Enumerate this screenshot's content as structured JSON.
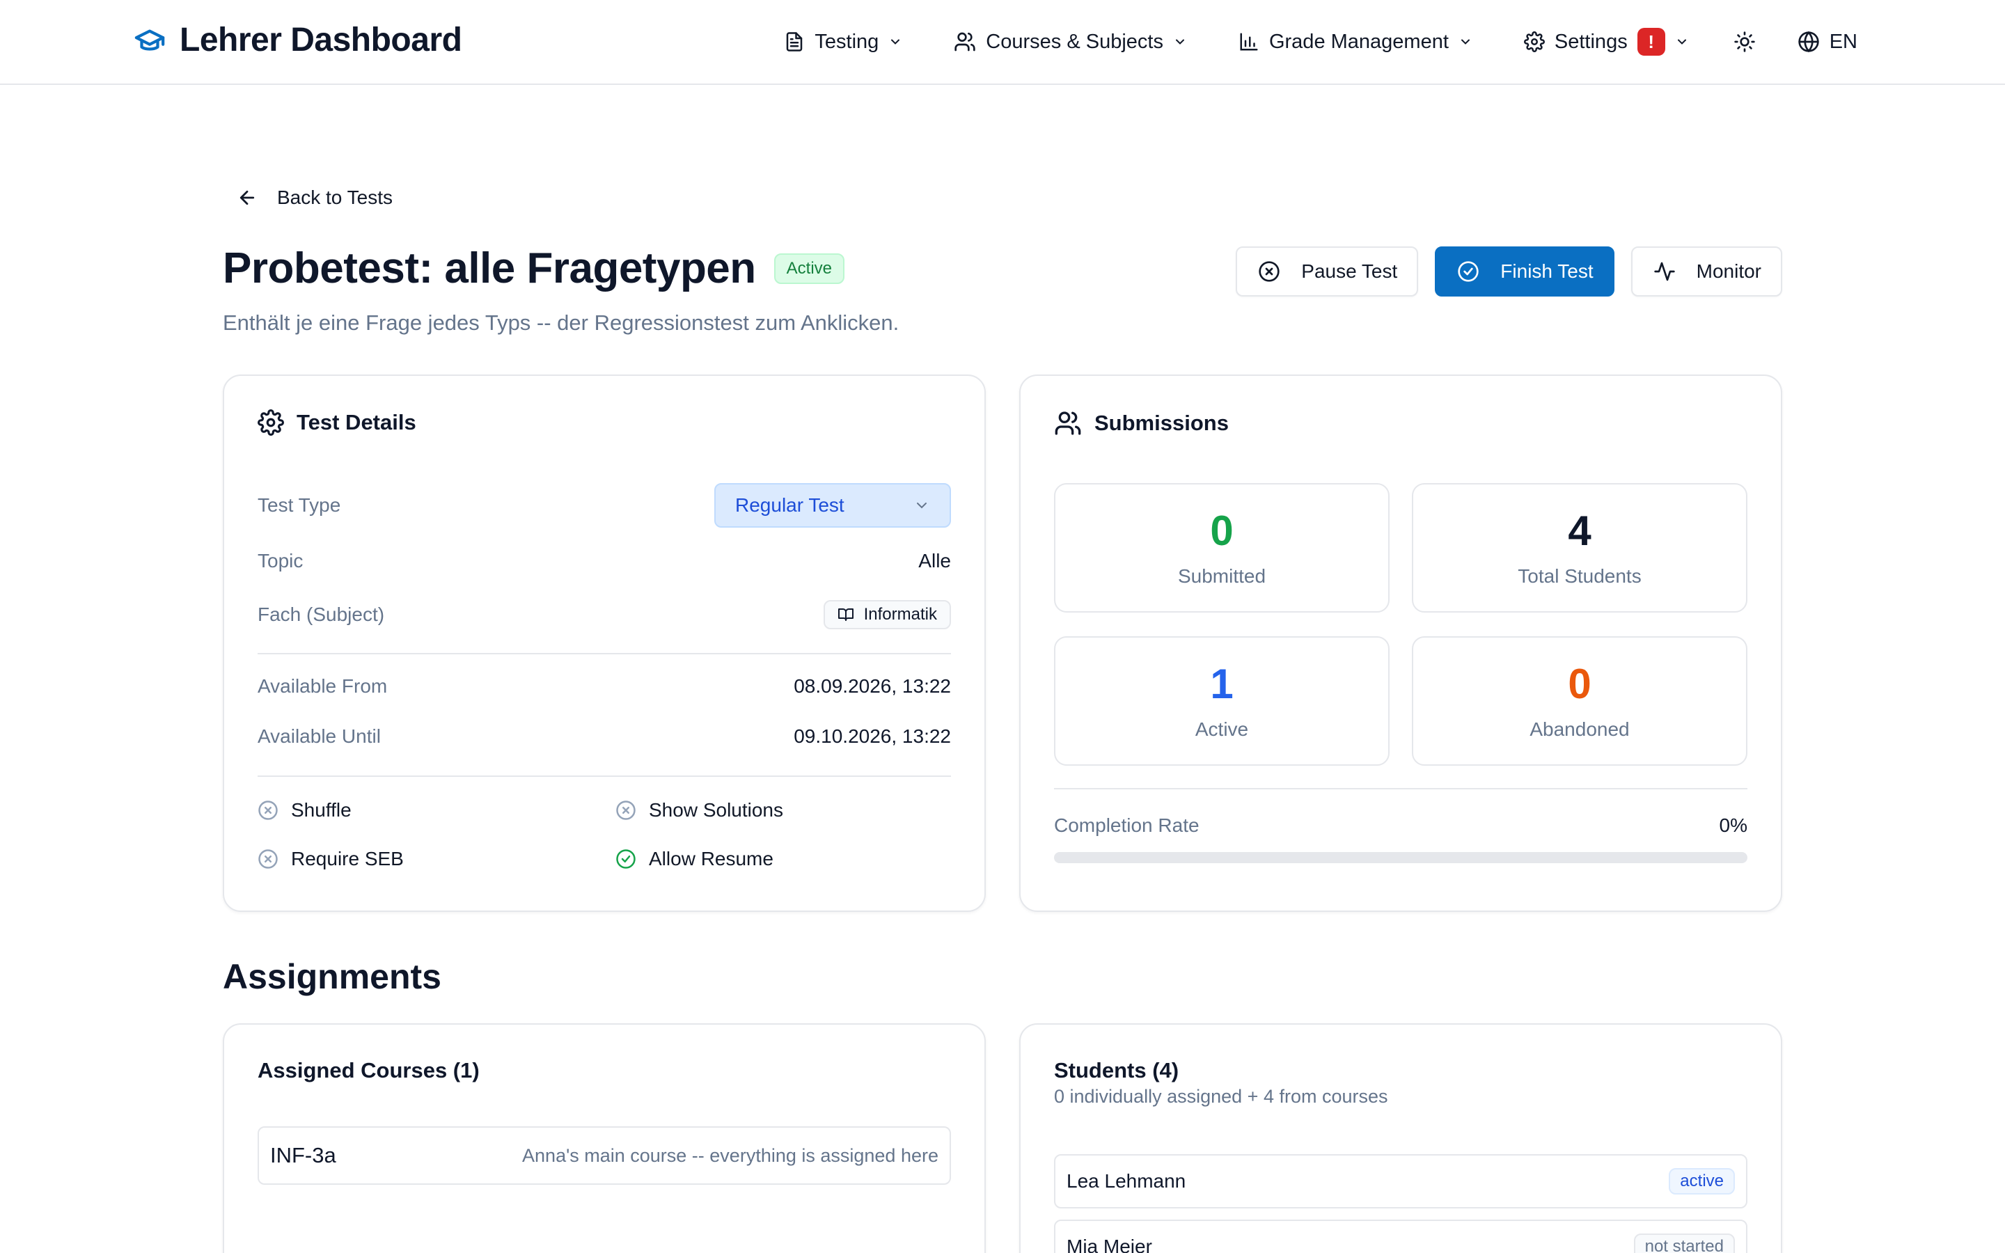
{
  "app": {
    "brand_icon": "graduation-cap-icon",
    "title": "Lehrer Dashboard",
    "accent_color": "#0a6fc2"
  },
  "nav": {
    "testing": "Testing",
    "courses": "Courses & Subjects",
    "grades": "Grade Management",
    "settings": "Settings",
    "settings_alert": "!",
    "language": "EN"
  },
  "header": {
    "back_label": "Back to Tests",
    "title": "Probetest: alle Fragetypen",
    "status": "Active",
    "description": "Enthält je eine Frage jedes Typs -- der Regressionstest zum Anklicken."
  },
  "actions": {
    "pause": "Pause Test",
    "finish": "Finish Test",
    "monitor": "Monitor"
  },
  "details": {
    "heading": "Test Details",
    "test_type_label": "Test Type",
    "test_type_value": "Regular Test",
    "topic_label": "Topic",
    "topic_value": "Alle",
    "subject_label": "Fach (Subject)",
    "subject_value": "Informatik",
    "available_from_label": "Available From",
    "available_from_value": "08.09.2026, 13:22",
    "available_until_label": "Available Until",
    "available_until_value": "09.10.2026, 13:22",
    "flags": {
      "shuffle": {
        "label": "Shuffle",
        "enabled": false
      },
      "show_solutions": {
        "label": "Show Solutions",
        "enabled": false
      },
      "require_seb": {
        "label": "Require SEB",
        "enabled": false
      },
      "allow_resume": {
        "label": "Allow Resume",
        "enabled": true
      }
    }
  },
  "submissions": {
    "heading": "Submissions",
    "submitted": {
      "value": "0",
      "label": "Submitted",
      "color": "#16a34a"
    },
    "total": {
      "value": "4",
      "label": "Total Students",
      "color": "#0f172a"
    },
    "active": {
      "value": "1",
      "label": "Active",
      "color": "#2563eb"
    },
    "abandoned": {
      "value": "0",
      "label": "Abandoned",
      "color": "#ea580c"
    },
    "completion_label": "Completion Rate",
    "completion_value": "0%",
    "completion_fraction": 0
  },
  "assignments": {
    "heading": "Assignments",
    "courses_title": "Assigned Courses (1)",
    "courses": [
      {
        "name": "INF-3a",
        "description": "Anna's main course -- everything is assigned here"
      }
    ],
    "students_title": "Students (4)",
    "students_subtitle": "0 individually assigned + 4 from courses",
    "students": [
      {
        "name": "Lea Lehmann",
        "status": "active"
      },
      {
        "name": "Mia Meier",
        "status": "not started"
      }
    ]
  }
}
